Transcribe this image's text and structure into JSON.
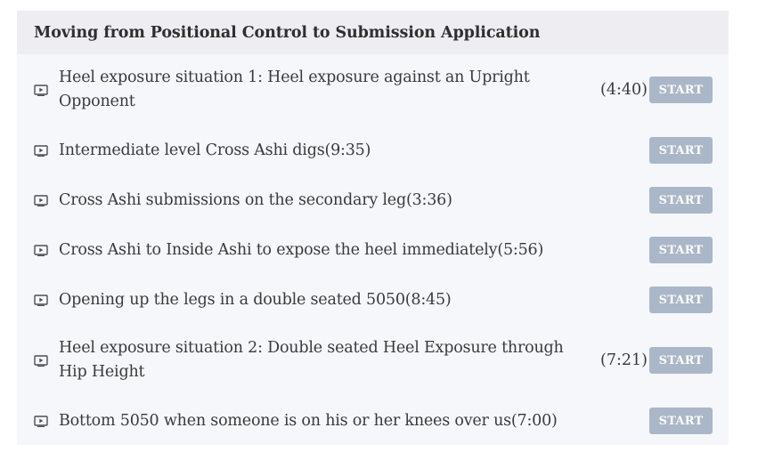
{
  "section": {
    "title": "Moving from Positional Control to Submission Application"
  },
  "lessons": [
    {
      "title": "Heel exposure situation 1: Heel exposure against an Upright Opponent",
      "duration": "(4:40)",
      "start_label": "START"
    },
    {
      "title": "Intermediate level Cross Ashi digs(9:35)",
      "duration": "",
      "start_label": "START"
    },
    {
      "title": "Cross Ashi submissions on the secondary leg(3:36)",
      "duration": "",
      "start_label": "START"
    },
    {
      "title": "Cross Ashi to Inside Ashi to expose the heel immediately(5:56)",
      "duration": "",
      "start_label": "START"
    },
    {
      "title": "Opening up the legs in a double seated 5050(8:45)",
      "duration": "",
      "start_label": "START"
    },
    {
      "title": "Heel exposure situation 2: Double seated Heel Exposure through Hip Height",
      "duration": "(7:21)",
      "start_label": "START"
    },
    {
      "title": "Bottom 5050 when someone is on his or her knees over us(7:00)",
      "duration": "",
      "start_label": "START"
    }
  ],
  "icons": {
    "lesson": "video-play-icon"
  },
  "colors": {
    "panel_bg": "#f6f7fb",
    "header_bg": "#eeeef2",
    "start_button_bg": "#aab7c8",
    "text": "#3a3a3a"
  }
}
